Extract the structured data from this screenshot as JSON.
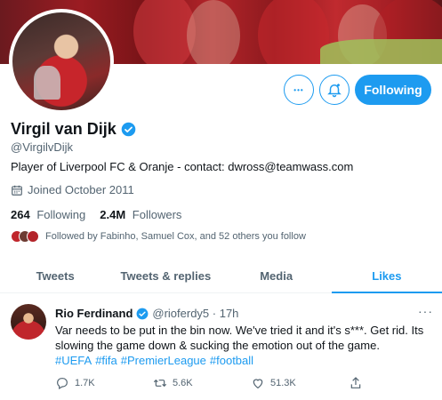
{
  "profile": {
    "display_name": "Virgil van Dijk",
    "handle": "@VirgilvDijk",
    "bio": "Player of Liverpool FC & Oranje - contact: dwross@teamwass.com",
    "joined": "Joined October 2011",
    "following_count": "264",
    "following_label": "Following",
    "followers_count": "2.4M",
    "followers_label": "Followers",
    "followed_by": "Followed by Fabinho, Samuel Cox, and 52 others you follow"
  },
  "actions": {
    "more_label": "•••",
    "follow_label": "Following"
  },
  "tabs": [
    {
      "label": "Tweets"
    },
    {
      "label": "Tweets & replies"
    },
    {
      "label": "Media"
    },
    {
      "label": "Likes"
    }
  ],
  "tweet": {
    "author": "Rio Ferdinand",
    "meta": "@rioferdy5 · 17h",
    "text": "Var needs to be put in the bin now. We've tried it and it's s***. Get rid. Its slowing the game down & sucking the emotion out of the game.",
    "hashtags": [
      "#UEFA",
      "#fifa",
      "#PremierLeague",
      "#football"
    ],
    "more": "···",
    "replies": "1.7K",
    "retweets": "5.6K",
    "likes": "51.3K"
  },
  "colors": {
    "accent": "#1d9bf0",
    "text": "#0f1419",
    "secondary": "#536471"
  }
}
